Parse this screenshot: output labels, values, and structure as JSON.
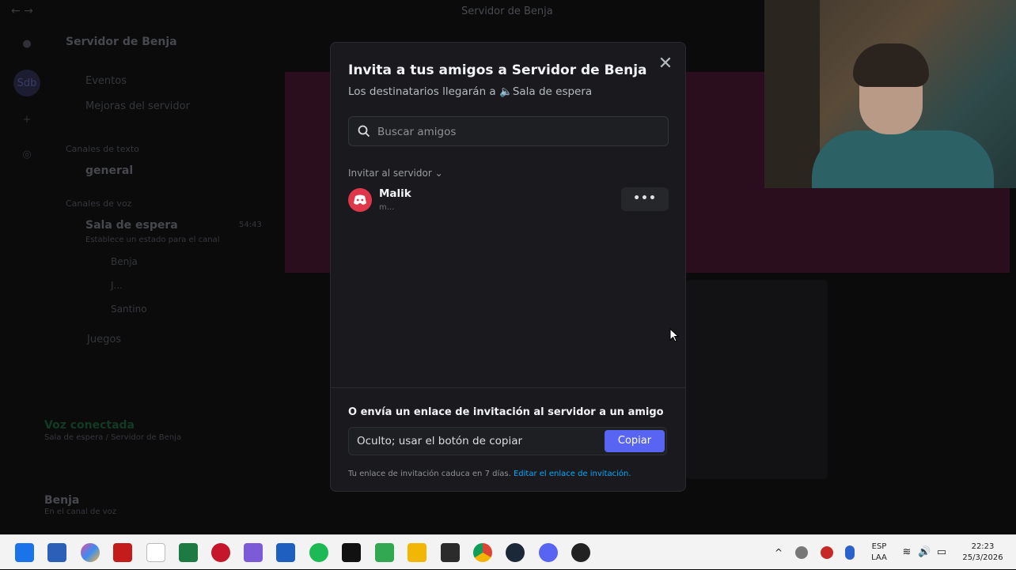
{
  "titlebar": {
    "title": "Servidor de Benja"
  },
  "sidebar": {
    "server_name": "Servidor de Benja",
    "server_abbr": "Sdb",
    "events": "Eventos",
    "boosts": "Mejoras del servidor",
    "text_cat": "Canales de texto",
    "text_channel": "general",
    "voice_cat": "Canales de voz",
    "voice_channel": "Sala de espera",
    "voice_timer": "54:43",
    "voice_status": "Establece un estado para el canal",
    "members": [
      "Benja",
      "J...",
      "Santino"
    ],
    "games_channel": "Juegos",
    "voice_connected": "Voz conectada",
    "voice_connected_sub": "Sala de espera / Servidor de Benja",
    "user_name": "Benja",
    "user_status": "En el canal de voz"
  },
  "modal": {
    "title": "Invita a tus amigos a Servidor de Benja",
    "subtitle_prefix": "Los destinatarios llegarán a",
    "subtitle_channel": "Sala de espera",
    "search_placeholder": "Buscar amigos",
    "section_label": "Invitar al servidor",
    "friend": {
      "name": "Malik",
      "sub": "m..."
    },
    "more_label": "•••",
    "link_title": "O envía un enlace de invitación al servidor a un amigo",
    "link_value": "Oculto; usar el botón de copiar",
    "copy_label": "Copiar",
    "expire_text": "Tu enlace de invitación caduca en 7 días.",
    "edit_link": "Editar el enlace de invitación."
  },
  "taskbar": {
    "lang_top": "ESP",
    "lang_bottom": "LAA",
    "time": "22:23",
    "date": "25/3/2026",
    "apps": [
      "start-icon",
      "store-icon",
      "copilot-icon",
      "acrobat-icon",
      "notepad-icon",
      "excel-icon",
      "app-red-icon",
      "app-bird-icon",
      "word-icon",
      "spotify-icon",
      "terminal-icon",
      "app-green-icon",
      "explorer-icon",
      "epic-icon",
      "chrome-icon",
      "steam-icon",
      "discord-icon",
      "obs-icon"
    ]
  },
  "colors": {
    "accent": "#5865f2",
    "danger": "#e0364a",
    "banner": "#2a0e1e",
    "link": "#00a8fc"
  }
}
